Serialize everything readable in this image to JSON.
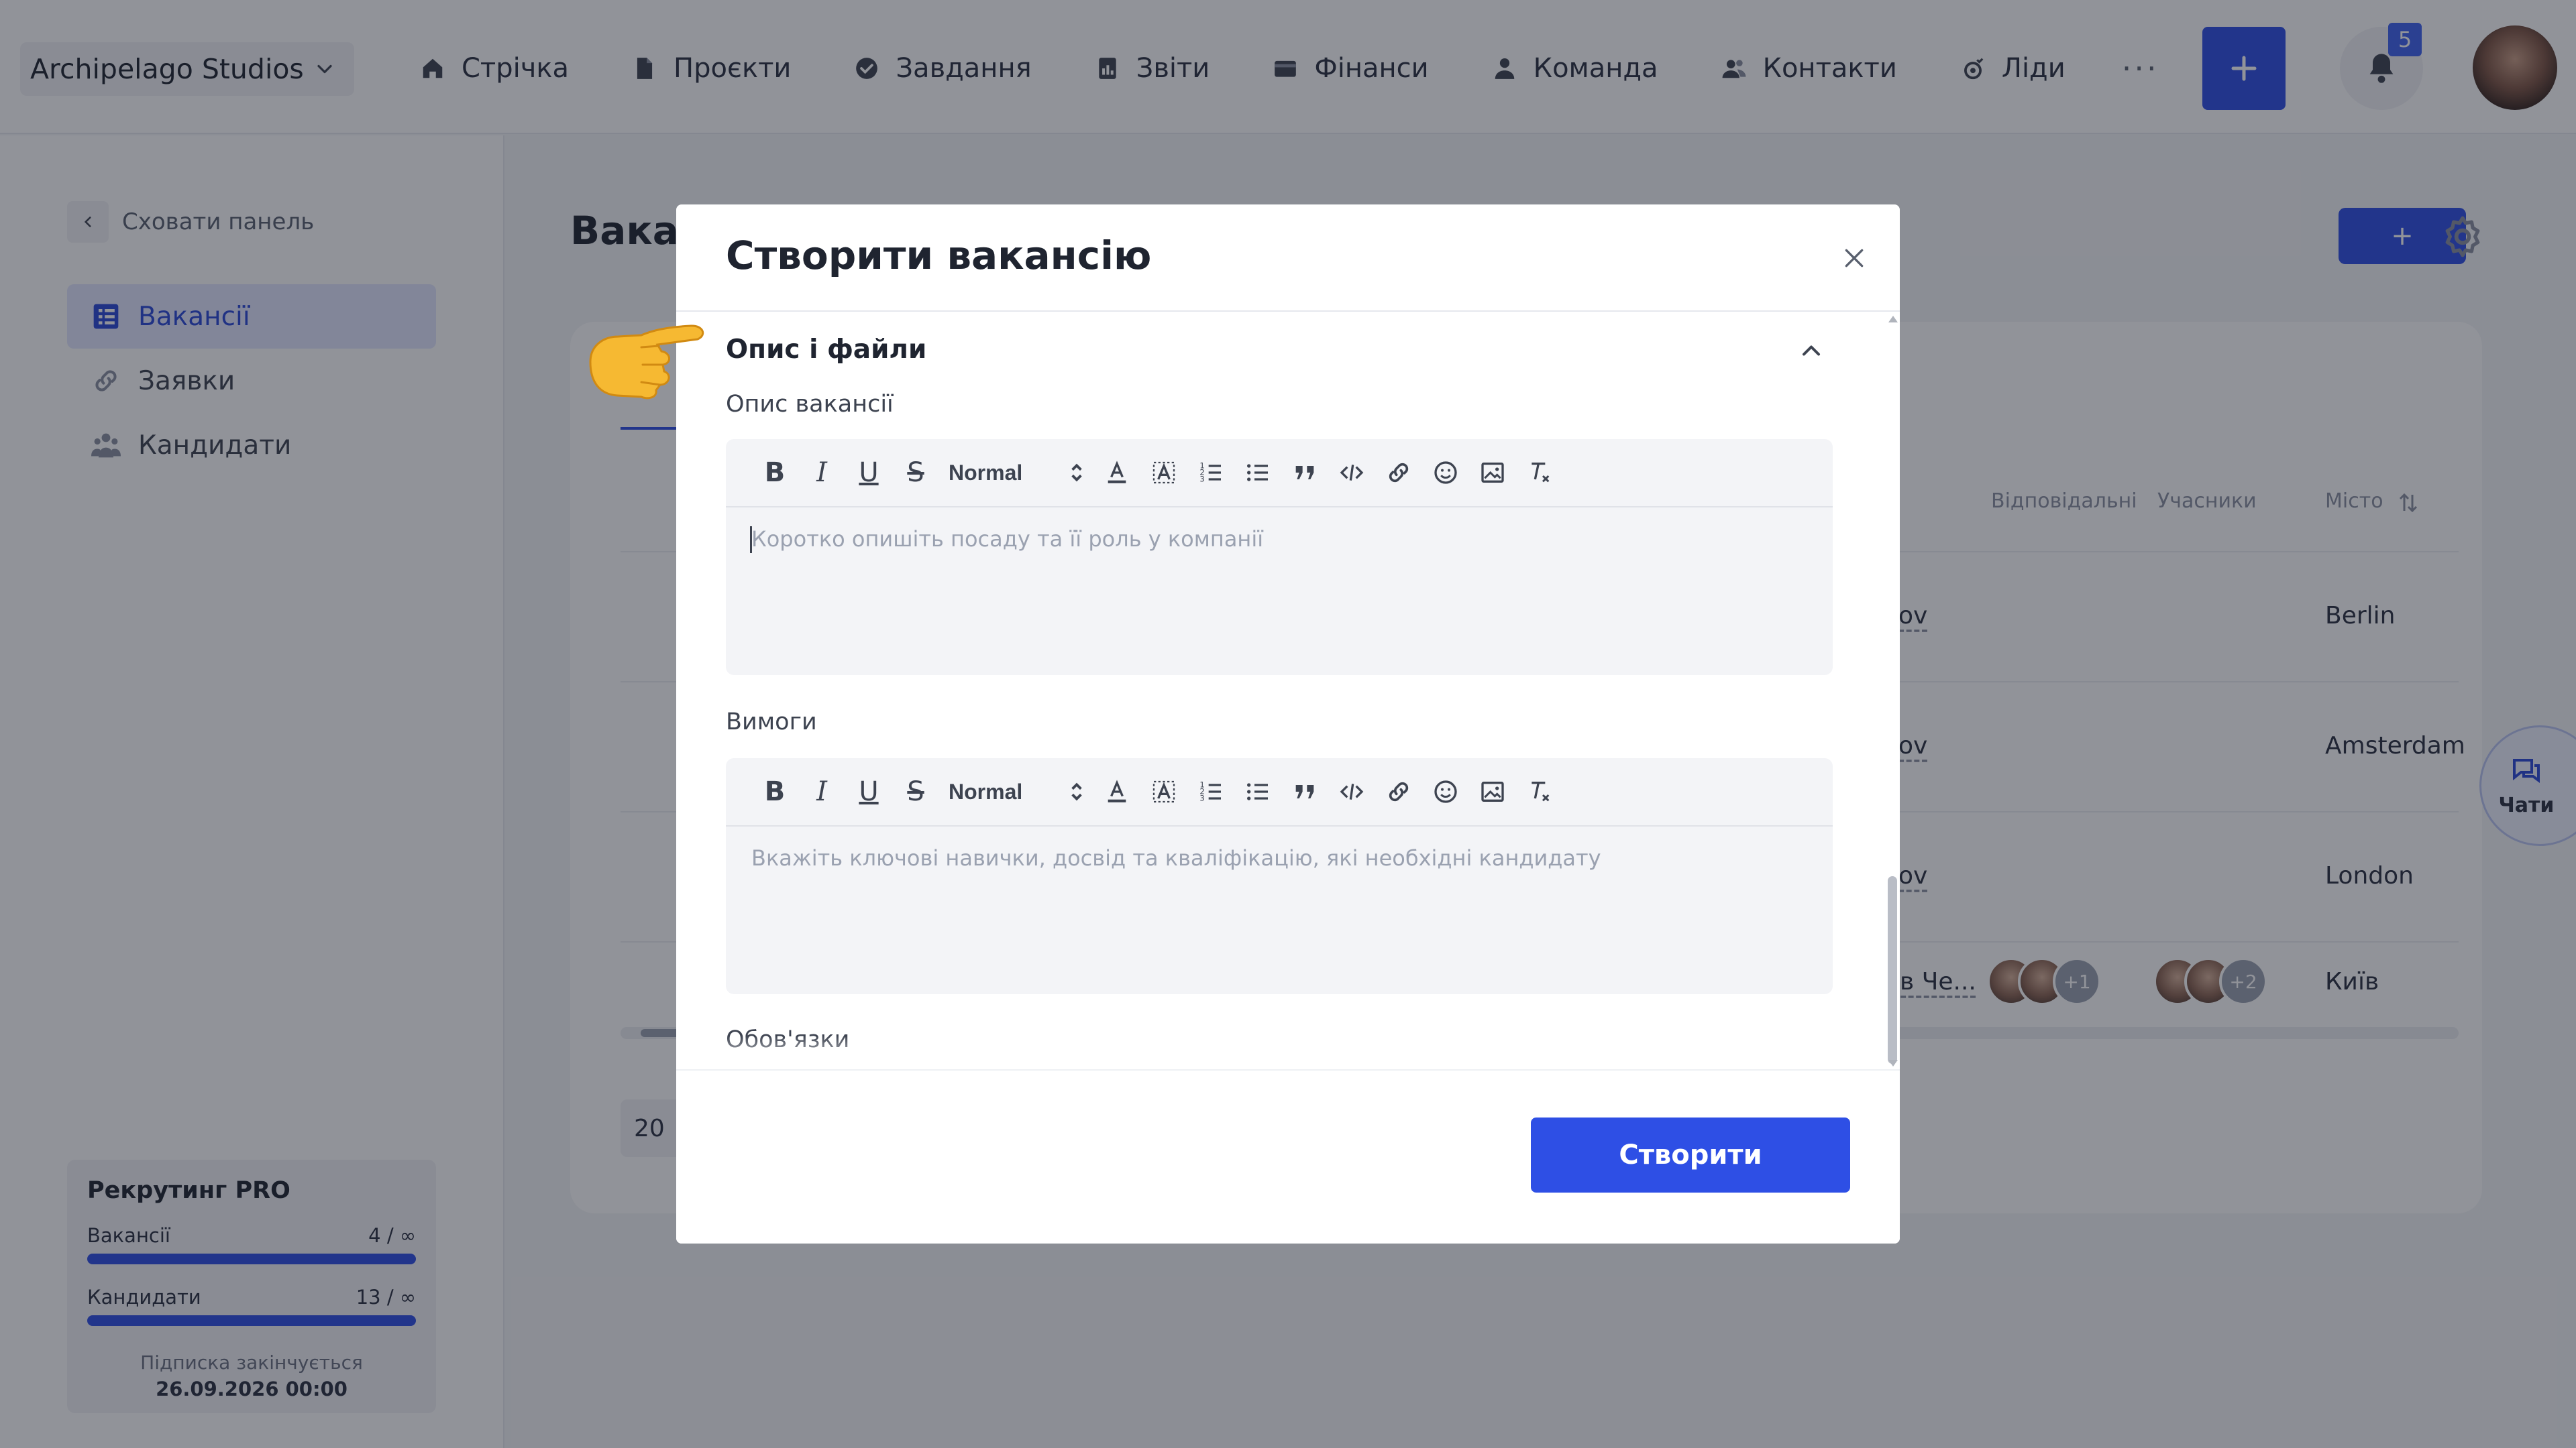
{
  "topbar": {
    "org_name": "Archipelago Studios",
    "nav": [
      {
        "label": "Стрічка",
        "icon": "home-icon"
      },
      {
        "label": "Проєкти",
        "icon": "document-icon"
      },
      {
        "label": "Завдання",
        "icon": "check-circle-icon"
      },
      {
        "label": "Звіти",
        "icon": "report-icon"
      },
      {
        "label": "Фінанси",
        "icon": "wallet-icon"
      },
      {
        "label": "Команда",
        "icon": "user-icon"
      },
      {
        "label": "Контакти",
        "icon": "contacts-icon"
      },
      {
        "label": "Ліди",
        "icon": "leads-icon"
      }
    ],
    "more_label": "···",
    "notifications_count": "5"
  },
  "sidebar": {
    "hide_panel_label": "Сховати панель",
    "items": [
      {
        "label": "Вакансії",
        "active": true
      },
      {
        "label": "Заявки",
        "active": false
      },
      {
        "label": "Кандидати",
        "active": false
      }
    ],
    "plan": {
      "title": "Рекрутинг PRO",
      "rows": [
        {
          "label": "Вакансії",
          "value": "4 / ∞"
        },
        {
          "label": "Кандидати",
          "value": "13 / ∞"
        }
      ],
      "expire_label": "Підписка закінчується",
      "expire_date": "26.09.2026 00:00"
    }
  },
  "main": {
    "title_partial": "Вакан",
    "add_label": "+",
    "columns": [
      "Відповідальні",
      "Учасники",
      "Місто"
    ],
    "rows": [
      {
        "resp_partial": "ov",
        "city": "Berlin"
      },
      {
        "resp_partial": "ov",
        "city": "Amsterdam"
      },
      {
        "resp_partial": "ov",
        "city": "London"
      },
      {
        "resp_partial": "ав Че...",
        "resp_more": "+1",
        "members_more": "+2",
        "city": "Київ"
      }
    ],
    "per_page": "20",
    "chat_label": "Чати"
  },
  "modal": {
    "title": "Створити вакансію",
    "section_title": "Опис і файли",
    "fields": [
      {
        "label": "Опис вакансії",
        "placeholder": "Коротко опишіть посаду та її роль у компанії"
      },
      {
        "label": "Вимоги",
        "placeholder": "Вкажіть ключові навички, досвід та кваліфікацію, які необхідні кандидату"
      }
    ],
    "third_field_label": "Обов'язки",
    "toolbar": {
      "bold": "B",
      "italic": "I",
      "underline": "U",
      "strike": "S",
      "format_value": "Normal"
    },
    "submit_label": "Створити"
  },
  "colors": {
    "primary": "#2e4fe5",
    "overlay": "rgba(22,26,38,0.47)"
  }
}
